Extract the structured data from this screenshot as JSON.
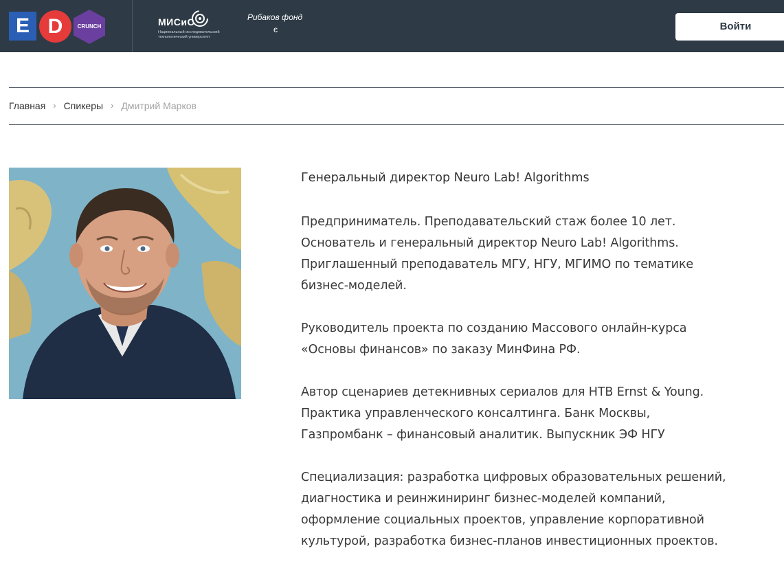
{
  "header": {
    "logo_e": "E",
    "logo_d": "D",
    "logo_crunch": "CRUNCH",
    "misis_name": "МИСиС",
    "misis_subtitle": "Национальный исследовательский технологический университет",
    "fond_name": "Рибаков фонд",
    "login_label": "Войти"
  },
  "breadcrumb": {
    "items": [
      "Главная",
      "Спикеры"
    ],
    "separator": "›",
    "current": "Дмитрий Марков"
  },
  "speaker": {
    "title": "Генеральный директор Neuro Lab! Algorithms",
    "paragraphs": [
      [
        "Предприниматель. Преподавательский стаж более 10 лет.",
        "Основатель и генеральный директор Neuro Lab! Algorithms.",
        "Приглашенный преподаватель МГУ, НГУ, МГИМО по тематике",
        "бизнес-моделей."
      ],
      [
        "Руководитель проекта по созданию Массового онлайн-курса",
        "«Основы финансов» по заказу МинФина РФ."
      ],
      [
        "Автор сценариев детекнивных сериалов для НТВ Ernst & Young.",
        "Практика управленческого консалтинга. Банк Москвы,",
        "Газпромбанк – финансовый аналитик. Выпускник ЭФ НГУ"
      ],
      [
        "Специализация: разработка цифровых образовательных решений,",
        "диагностика и реинжиниринг бизнес-моделей компаний,",
        "оформление социальных проектов, управление корпоративной",
        "культурой, разработка бизнес-планов инвестиционных проектов."
      ]
    ]
  },
  "colors": {
    "header_bg": "#2e3b46",
    "logo_e": "#2b5fb5",
    "logo_d": "#e53b3b",
    "logo_crunch": "#6b3fa0"
  }
}
